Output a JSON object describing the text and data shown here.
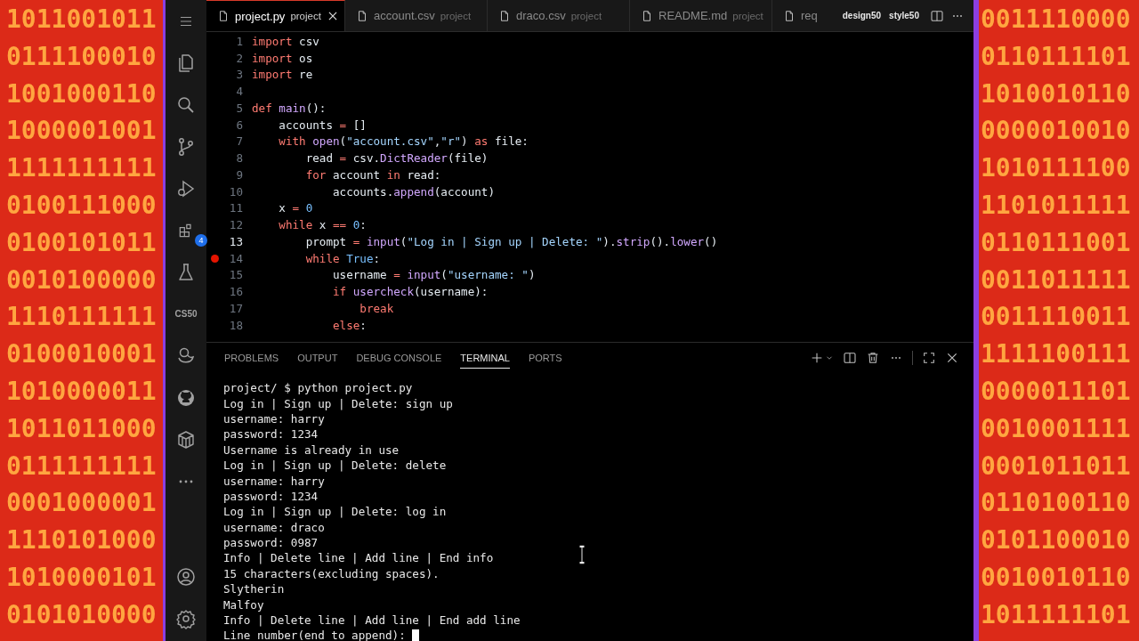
{
  "background": {
    "left_rows": [
      "1011001011",
      "0111100010",
      "1001000110",
      "1000001001",
      "1111111111",
      "0100111000",
      "0100101011",
      "0010100000",
      "1110111111",
      "0100010001",
      "1010000011",
      "1011011000",
      "0111111111",
      "0001000001",
      "1110101000",
      "1010000101",
      "0101010000"
    ],
    "right_rows": [
      "0011110000",
      "0110111101",
      "1010010110",
      "0000010010",
      "1010111100",
      "1101011111",
      "0110111001",
      "0011011111",
      "0011110011",
      "1111100111",
      "0000011101",
      "0010001111",
      "0001011011",
      "0110100110",
      "0101100010",
      "0010010110",
      "1011111101"
    ]
  },
  "activity_bar": {
    "items": [
      {
        "kind": "files"
      },
      {
        "kind": "search"
      },
      {
        "kind": "source-control"
      },
      {
        "kind": "run-debug"
      },
      {
        "kind": "extensions",
        "badge": "4"
      },
      {
        "kind": "testing"
      },
      {
        "kind": "text",
        "label": "CS50"
      },
      {
        "kind": "duck"
      },
      {
        "kind": "github"
      },
      {
        "kind": "container"
      },
      {
        "kind": "more"
      }
    ],
    "bottom": [
      {
        "kind": "account"
      },
      {
        "kind": "settings"
      }
    ]
  },
  "tabs": [
    {
      "label": "project.py",
      "description": "project",
      "selected": true
    },
    {
      "label": "account.csv",
      "description": "project",
      "selected": false
    },
    {
      "label": "draco.csv",
      "description": "project",
      "selected": false
    },
    {
      "label": "README.md",
      "description": "project",
      "selected": false
    },
    {
      "label": "req",
      "selected": false
    }
  ],
  "editor_actions": [
    "design50",
    "style50"
  ],
  "editor": {
    "lines": [
      {
        "number": "1",
        "tokens": [
          {
            "kind": "keyword",
            "text": "import"
          },
          {
            "kind": "name",
            "text": " csv"
          }
        ]
      },
      {
        "number": "2",
        "tokens": [
          {
            "kind": "keyword",
            "text": "import"
          },
          {
            "kind": "name",
            "text": " os"
          }
        ]
      },
      {
        "number": "3",
        "tokens": [
          {
            "kind": "keyword",
            "text": "import"
          },
          {
            "kind": "name",
            "text": " re"
          }
        ]
      },
      {
        "number": "4"
      },
      {
        "number": "5",
        "tokens": [
          {
            "kind": "keyword",
            "text": "def"
          },
          {
            "kind": "function",
            "text": " main"
          },
          {
            "kind": "plain",
            "text": "():"
          }
        ]
      },
      {
        "number": "6",
        "tokens": [
          {
            "kind": "plain",
            "text": "    accounts "
          },
          {
            "kind": "keyword",
            "text": "="
          },
          {
            "kind": "plain",
            "text": " []"
          }
        ]
      },
      {
        "number": "7",
        "tokens": [
          {
            "kind": "keyword",
            "text": "    with"
          },
          {
            "kind": "function",
            "text": " open"
          },
          {
            "kind": "plain",
            "text": "("
          },
          {
            "kind": "string",
            "text": "\"account.csv\""
          },
          {
            "kind": "plain",
            "text": ","
          },
          {
            "kind": "string",
            "text": "\"r\""
          },
          {
            "kind": "plain",
            "text": ") "
          },
          {
            "kind": "keyword",
            "text": "as"
          },
          {
            "kind": "plain",
            "text": " file:"
          }
        ]
      },
      {
        "number": "8",
        "tokens": [
          {
            "kind": "plain",
            "text": "        read "
          },
          {
            "kind": "keyword",
            "text": "="
          },
          {
            "kind": "name",
            "text": " csv."
          },
          {
            "kind": "function",
            "text": "DictReader"
          },
          {
            "kind": "plain",
            "text": "(file)"
          }
        ]
      },
      {
        "number": "9",
        "tokens": [
          {
            "kind": "keyword",
            "text": "        for"
          },
          {
            "kind": "plain",
            "text": " account "
          },
          {
            "kind": "keyword",
            "text": "in"
          },
          {
            "kind": "plain",
            "text": " read:"
          }
        ]
      },
      {
        "number": "10",
        "tokens": [
          {
            "kind": "plain",
            "text": "            accounts."
          },
          {
            "kind": "function",
            "text": "append"
          },
          {
            "kind": "plain",
            "text": "(account)"
          }
        ]
      },
      {
        "number": "11",
        "tokens": [
          {
            "kind": "plain",
            "text": "    x "
          },
          {
            "kind": "keyword",
            "text": "="
          },
          {
            "kind": "number",
            "text": " 0"
          }
        ]
      },
      {
        "number": "12",
        "tokens": [
          {
            "kind": "keyword",
            "text": "    while"
          },
          {
            "kind": "plain",
            "text": " x "
          },
          {
            "kind": "keyword",
            "text": "=="
          },
          {
            "kind": "number",
            "text": " 0"
          },
          {
            "kind": "plain",
            "text": ":"
          }
        ]
      },
      {
        "number": "13",
        "current": true,
        "tokens": [
          {
            "kind": "plain",
            "text": "        prompt "
          },
          {
            "kind": "keyword",
            "text": "="
          },
          {
            "kind": "function",
            "text": " input"
          },
          {
            "kind": "plain",
            "text": "("
          },
          {
            "kind": "string",
            "text": "\"Log in | Sign up | Delete: \""
          },
          {
            "kind": "plain",
            "text": ")."
          },
          {
            "kind": "function",
            "text": "strip"
          },
          {
            "kind": "plain",
            "text": "()."
          },
          {
            "kind": "function",
            "text": "lower"
          },
          {
            "kind": "plain",
            "text": "()"
          }
        ]
      },
      {
        "number": "14",
        "breakpoint": true,
        "tokens": [
          {
            "kind": "keyword",
            "text": "        while"
          },
          {
            "kind": "number",
            "text": " True"
          },
          {
            "kind": "plain",
            "text": ":"
          }
        ]
      },
      {
        "number": "15",
        "tokens": [
          {
            "kind": "plain",
            "text": "            username "
          },
          {
            "kind": "keyword",
            "text": "="
          },
          {
            "kind": "function",
            "text": " input"
          },
          {
            "kind": "plain",
            "text": "("
          },
          {
            "kind": "string",
            "text": "\"username: \""
          },
          {
            "kind": "plain",
            "text": ")"
          }
        ]
      },
      {
        "number": "16",
        "tokens": [
          {
            "kind": "keyword",
            "text": "            if"
          },
          {
            "kind": "function",
            "text": " usercheck"
          },
          {
            "kind": "plain",
            "text": "(username):"
          }
        ]
      },
      {
        "number": "17",
        "tokens": [
          {
            "kind": "keyword",
            "text": "                break"
          }
        ]
      },
      {
        "number": "18",
        "tokens": [
          {
            "kind": "keyword",
            "text": "            else"
          },
          {
            "kind": "plain",
            "text": ":"
          }
        ]
      }
    ]
  },
  "panel": {
    "tabs": [
      {
        "label": "PROBLEMS",
        "selected": false
      },
      {
        "label": "OUTPUT",
        "selected": false
      },
      {
        "label": "DEBUG CONSOLE",
        "selected": false
      },
      {
        "label": "TERMINAL",
        "selected": true
      },
      {
        "label": "PORTS",
        "selected": false
      }
    ],
    "terminal": {
      "lines": [
        "project/ $ python project.py",
        "Log in | Sign up | Delete: sign up",
        "username: harry",
        "password: 1234",
        "Username is already in use",
        "Log in | Sign up | Delete: delete",
        "username: harry",
        "password: 1234",
        "Log in | Sign up | Delete: log in",
        "username: draco",
        "password: 0987",
        "Info | Delete line | Add line | End info",
        "15 characters(excluding spaces).",
        "Slytherin",
        "Malfoy",
        "Info | Delete line | Add line | End add line",
        "Line number(end to append): "
      ],
      "cursor": true
    }
  }
}
